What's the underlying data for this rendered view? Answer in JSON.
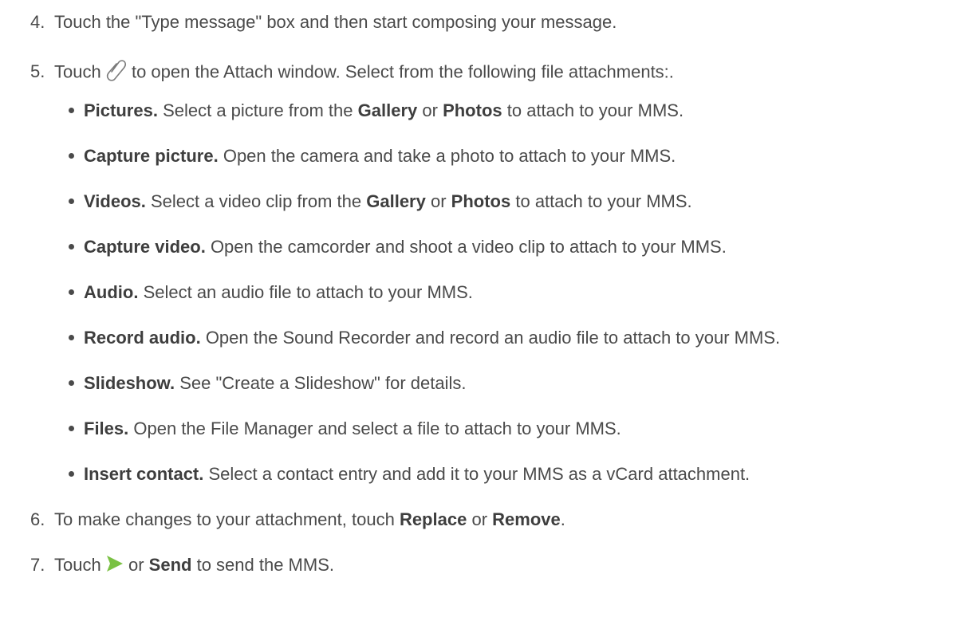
{
  "steps": {
    "s4": {
      "num": "4.",
      "text": "Touch the \"Type message\" box and then start composing your message."
    },
    "s5": {
      "num": "5.",
      "pre": "Touch",
      "post": "to open the Attach window. Select from the following file attachments:."
    },
    "s6": {
      "num": "6.",
      "pre": "To make changes to your attachment, touch",
      "b1": "Replace",
      "mid": "or",
      "b2": "Remove",
      "end": "."
    },
    "s7": {
      "num": "7.",
      "pre": "Touch",
      "mid": "or",
      "b1": "Send",
      "post": "to send the MMS."
    }
  },
  "bullets": [
    {
      "term": "Pictures.",
      "t1": "Select a picture from the",
      "b1": "Gallery",
      "t2": "or",
      "b2": "Photos",
      "t3": "to attach to your MMS."
    },
    {
      "term": "Capture picture.",
      "t1": "Open the camera and take a photo to attach to your MMS."
    },
    {
      "term": "Videos.",
      "t1": "Select a video clip from the",
      "b1": "Gallery",
      "t2": "or",
      "b2": "Photos",
      "t3": "to attach to your MMS."
    },
    {
      "term": "Capture video.",
      "t1": "Open the camcorder and shoot a video clip to attach to your MMS."
    },
    {
      "term": "Audio.",
      "t1": "Select an audio file to attach to your MMS."
    },
    {
      "term": "Record audio.",
      "t1": "Open the Sound Recorder and record an audio file to attach to your MMS."
    },
    {
      "term": "Slideshow.",
      "t1": "See \"Create a Slideshow\" for details."
    },
    {
      "term": "Files.",
      "t1": "Open the File Manager and select a file to attach to your MMS."
    },
    {
      "term": "Insert contact.",
      "t1": "Select a contact entry and add it to your MMS as a vCard attachment."
    }
  ],
  "icons": {
    "attach": "paperclip-icon",
    "send": "send-arrow-icon",
    "send_color": "#7ac143"
  }
}
